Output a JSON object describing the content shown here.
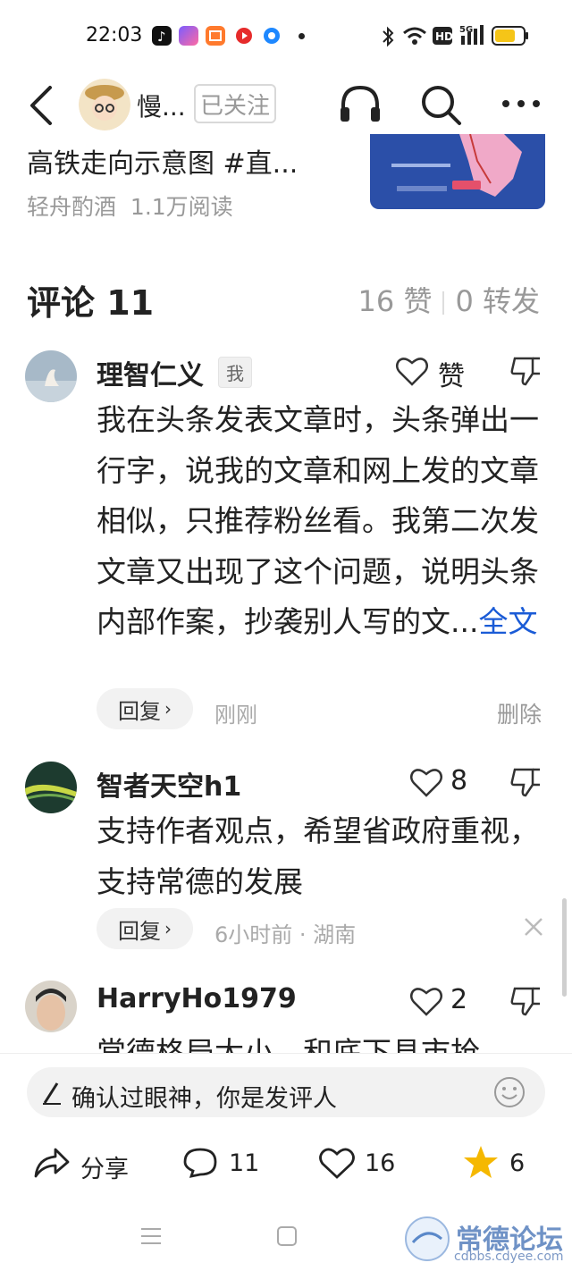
{
  "status_bar": {
    "time": "22:03",
    "network": "5G",
    "battery_level": 0.72
  },
  "header": {
    "author_name": "慢...",
    "follow_label": "已关注"
  },
  "article": {
    "title": "高铁走向示意图 #直...",
    "source": "轻舟酌酒",
    "reads": "1.1万阅读"
  },
  "comments_section": {
    "title": "评论 11",
    "likes": "16 赞",
    "reposts": "0 转发"
  },
  "comments": [
    {
      "user": "理智仁义",
      "tag": "我",
      "like_label": "赞",
      "text": "我在头条发表文章时，头条弹出一行字，说我的文章和网上发的文章相似，只推荐粉丝看。我第二次发文章又出现了这个问题，说明头条内部作案，抄袭别人写的文...",
      "full_label": "全文",
      "reply_label": "回复",
      "time": "刚刚",
      "action_label": "删除"
    },
    {
      "user": "智者天空h1",
      "like_label": "8",
      "text": "支持作者观点，希望省政府重视，支持常德的发展",
      "reply_label": "回复",
      "time": "6小时前 · 湖南"
    },
    {
      "user": "HarryHo1979",
      "like_label": "2",
      "text": "常德格局太小，和底下县市抢"
    }
  ],
  "input": {
    "placeholder": "确认过眼神，你是发评人"
  },
  "actions": {
    "share": "分享",
    "comments": "11",
    "likes": "16",
    "favorites": "6"
  },
  "watermark": {
    "text": "常德论坛",
    "url": "cdbbs.cdyee.com"
  },
  "colors": {
    "link": "#1a5bd6",
    "star": "#f5b800",
    "battery": "#f5c518"
  }
}
